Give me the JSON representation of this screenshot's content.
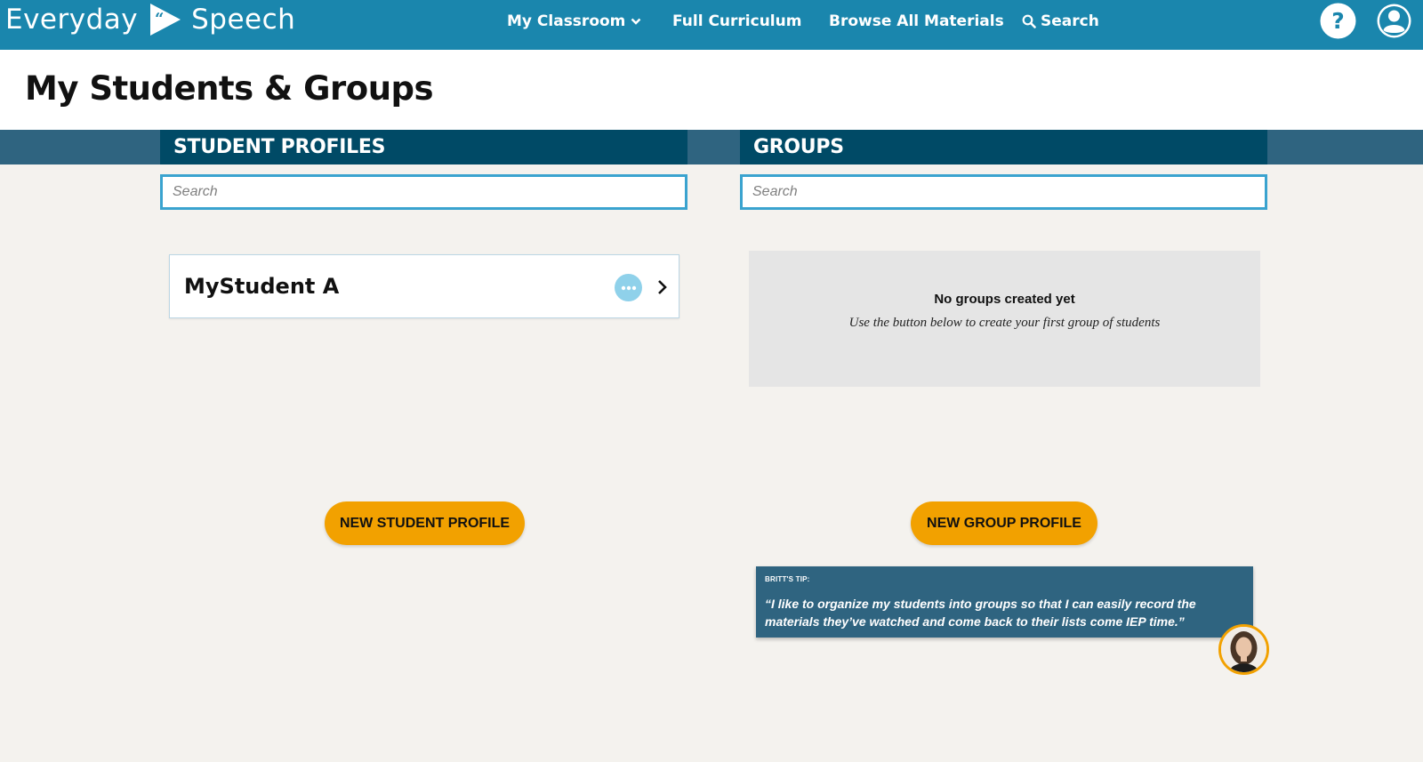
{
  "brand": {
    "name_left": "Everyday",
    "name_right": "Speech",
    "color_primary": "#1a86ad",
    "color_accent": "#f2a100"
  },
  "nav": {
    "items": [
      {
        "label": "My Classroom",
        "icon": "chevron-down-icon"
      },
      {
        "label": "Full Curriculum"
      },
      {
        "label": "Browse All Materials"
      },
      {
        "label": "Search",
        "icon": "search-icon"
      }
    ],
    "right_icons": [
      "help-icon",
      "user-account-icon"
    ]
  },
  "page": {
    "title": "My Students & Groups"
  },
  "students": {
    "header": "STUDENT PROFILES",
    "search_placeholder": "Search",
    "items": [
      {
        "name": "MyStudent A"
      }
    ],
    "new_button": "NEW STUDENT PROFILE"
  },
  "groups": {
    "header": "GROUPS",
    "search_placeholder": "Search",
    "empty_title": "No groups created yet",
    "empty_subtitle": "Use the button below to create your first group of students",
    "new_button": "NEW GROUP PROFILE"
  },
  "tip": {
    "label": "BRITT'S TIP:",
    "quote": "“I like to organize my students into groups so that I can easily record the materials they’ve watched and come back to their lists come IEP time.”"
  }
}
